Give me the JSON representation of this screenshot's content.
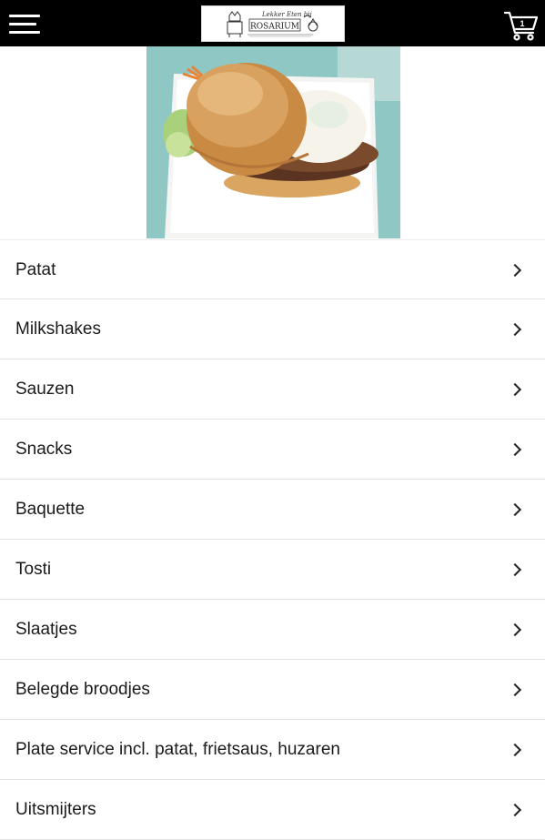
{
  "header": {
    "logo_text": "ROSARIUM",
    "logo_script": "Lekker Eten bij",
    "cart_count": "1"
  },
  "hero": {
    "alt": "Hamburger met ei"
  },
  "menu": {
    "items": [
      {
        "label": "Patat"
      },
      {
        "label": "Milkshakes"
      },
      {
        "label": "Sauzen"
      },
      {
        "label": "Snacks"
      },
      {
        "label": "Baquette"
      },
      {
        "label": "Tosti"
      },
      {
        "label": "Slaatjes"
      },
      {
        "label": "Belegde broodjes"
      },
      {
        "label": "Plate service incl. patat, frietsaus, huzaren"
      },
      {
        "label": "Uitsmijters"
      }
    ]
  },
  "colors": {
    "topbar": "#000000",
    "text": "#1a1a1a",
    "divider": "#e2e2e2"
  }
}
